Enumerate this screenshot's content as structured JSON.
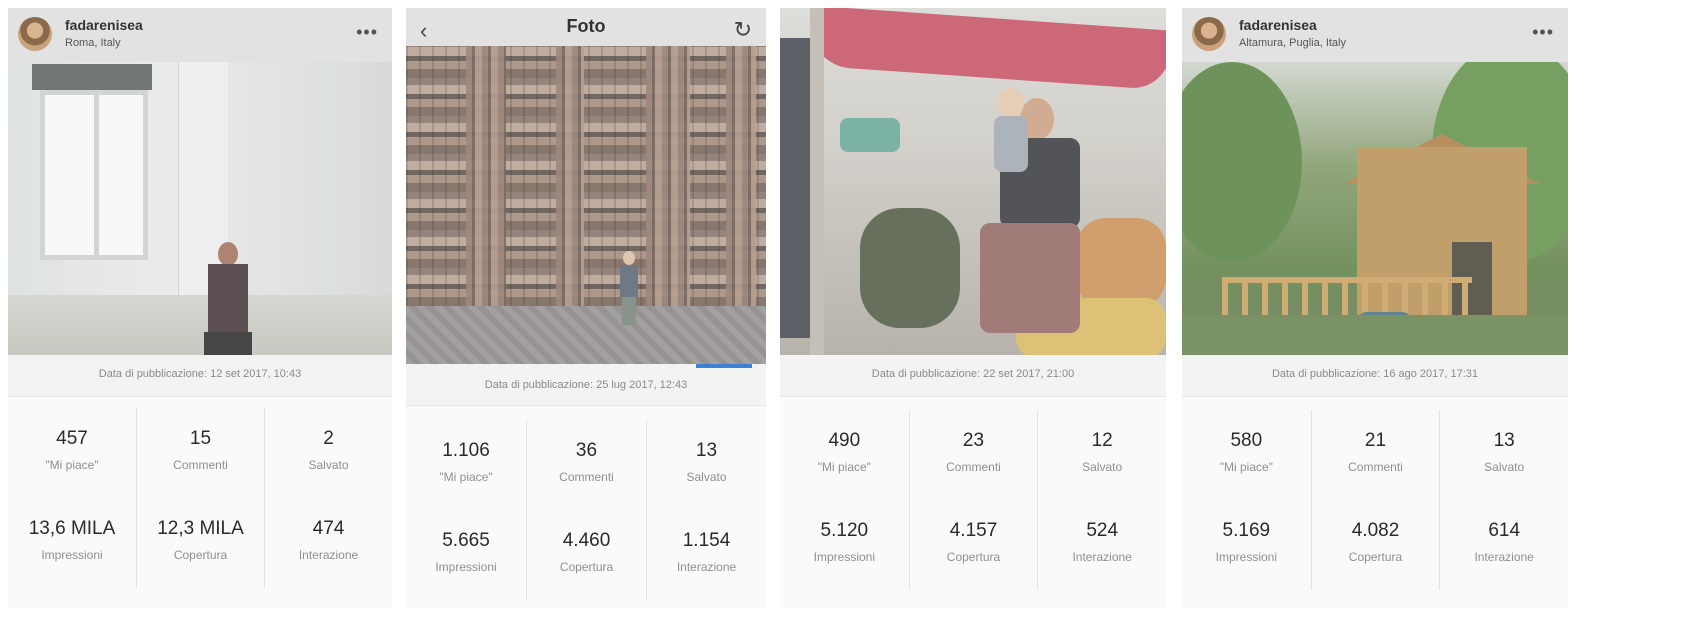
{
  "panels": [
    {
      "header": {
        "type": "profile",
        "username": "fadarenisea",
        "location": "Roma, Italy",
        "more": "•••"
      },
      "published": "Data di pubblicazione: 12 set 2017, 10:43",
      "stats": [
        {
          "value": "457",
          "label": "\"Mi piace\""
        },
        {
          "value": "15",
          "label": "Commenti"
        },
        {
          "value": "2",
          "label": "Salvato"
        },
        {
          "value": "13,6 MILA",
          "label": "Impressioni"
        },
        {
          "value": "12,3 MILA",
          "label": "Copertura"
        },
        {
          "value": "474",
          "label": "Interazione"
        }
      ]
    },
    {
      "header": {
        "type": "title",
        "title": "Foto",
        "back": "‹",
        "refresh": "↻"
      },
      "published": "Data di pubblicazione: 25 lug 2017, 12:43",
      "stats": [
        {
          "value": "1.106",
          "label": "\"Mi piace\""
        },
        {
          "value": "36",
          "label": "Commenti"
        },
        {
          "value": "13",
          "label": "Salvato"
        },
        {
          "value": "5.665",
          "label": "Impressioni"
        },
        {
          "value": "4.460",
          "label": "Copertura"
        },
        {
          "value": "1.154",
          "label": "Interazione"
        }
      ]
    },
    {
      "header": {
        "type": "none"
      },
      "published": "Data di pubblicazione: 22 set 2017, 21:00",
      "stats": [
        {
          "value": "490",
          "label": "\"Mi piace\""
        },
        {
          "value": "23",
          "label": "Commenti"
        },
        {
          "value": "12",
          "label": "Salvato"
        },
        {
          "value": "5.120",
          "label": "Impressioni"
        },
        {
          "value": "4.157",
          "label": "Copertura"
        },
        {
          "value": "524",
          "label": "Interazione"
        }
      ]
    },
    {
      "header": {
        "type": "profile",
        "username": "fadarenisea",
        "location": "Altamura, Puglia, Italy",
        "more": "•••"
      },
      "published": "Data di pubblicazione: 16 ago 2017, 17:31",
      "stats": [
        {
          "value": "580",
          "label": "\"Mi piace\""
        },
        {
          "value": "21",
          "label": "Commenti"
        },
        {
          "value": "13",
          "label": "Salvato"
        },
        {
          "value": "5.169",
          "label": "Impressioni"
        },
        {
          "value": "4.082",
          "label": "Copertura"
        },
        {
          "value": "614",
          "label": "Interazione"
        }
      ]
    }
  ]
}
